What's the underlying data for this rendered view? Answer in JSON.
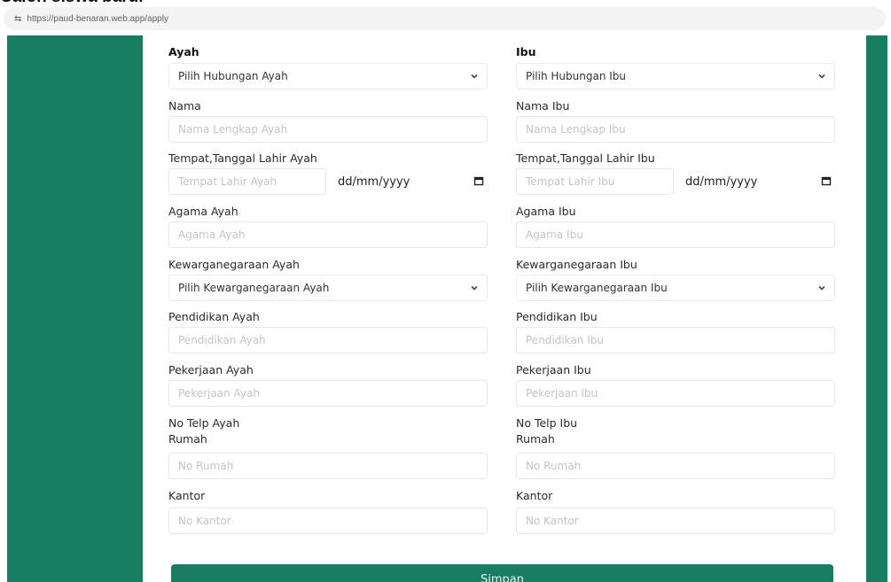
{
  "page": {
    "heading": "Calon siswa baru."
  },
  "browser": {
    "url": "https://paud-benaran.web.app/apply"
  },
  "form": {
    "ayah": {
      "heading": "Ayah",
      "hubungan_select": "Pilih Hubungan Ayah",
      "nama_label": "Nama",
      "nama_placeholder": "Nama Lengkap Ayah",
      "ttl_label": "Tempat,Tanggal Lahir Ayah",
      "tempat_placeholder": "Tempat Lahir Ayah",
      "tanggal_value": "dd/mm/yyyy",
      "agama_label": "Agama Ayah",
      "agama_placeholder": "Agama Ayah",
      "kewarganegaraan_label": "Kewarganegaraan Ayah",
      "kewarganegaraan_select": "Pilih Kewarganegaraan Ayah",
      "pendidikan_label": "Pendidikan Ayah",
      "pendidikan_placeholder": "Pendidikan Ayah",
      "pekerjaan_label": "Pekerjaan Ayah",
      "pekerjaan_placeholder": "Pekerjaan Ayah",
      "telp_label": "No Telp Ayah",
      "rumah_label": "Rumah",
      "rumah_placeholder": "No Rumah",
      "kantor_label": "Kantor",
      "kantor_placeholder": "No Kantor"
    },
    "ibu": {
      "heading": "Ibu",
      "hubungan_select": "Pilih Hubungan Ibu",
      "nama_label": "Nama Ibu",
      "nama_placeholder": "Nama Lengkap Ibu",
      "ttl_label": "Tempat,Tanggal Lahir Ibu",
      "tempat_placeholder": "Tempat Lahir Ibu",
      "tanggal_value": "dd/mm/yyyy",
      "agama_label": "Agama Ibu",
      "agama_placeholder": "Agama Ibu",
      "kewarganegaraan_label": "Kewarganegaraan Ibu",
      "kewarganegaraan_select": "Pilih Kewarganegaraan Ibu",
      "pendidikan_label": "Pendidikan Ibu",
      "pendidikan_placeholder": "Pendidikan Ibu",
      "pekerjaan_label": "Pekerjaan Ibu",
      "pekerjaan_placeholder": "Pekerjaan Ibu",
      "telp_label": "No Telp Ibu",
      "rumah_label": "Rumah",
      "rumah_placeholder": "No Rumah",
      "kantor_label": "Kantor",
      "kantor_placeholder": "No Kantor"
    },
    "submit_label": "Simpan"
  },
  "icons": {
    "site_info": "tune-icon",
    "select": "chevron-down-icon",
    "date": "calendar-icon"
  },
  "colors": {
    "brand": "#177e62",
    "background": "#ffffff"
  }
}
